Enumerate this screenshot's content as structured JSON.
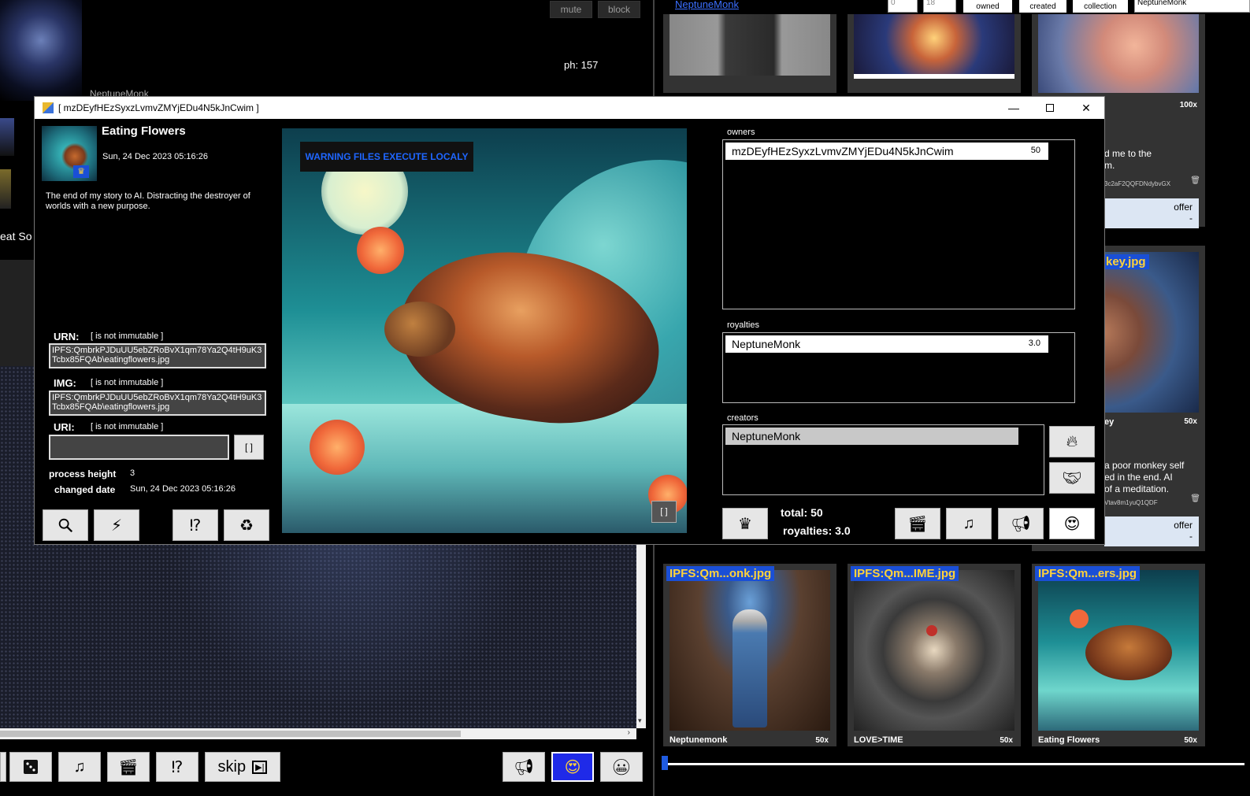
{
  "background_left": {
    "mute_label": "mute",
    "block_label": "block",
    "ph_text": "ph: 157",
    "partial_name": "NeptuneMonk",
    "partial_text": "eat So",
    "bottom_skip_label": "skip"
  },
  "background_right": {
    "top_link": "NeptuneMonk",
    "input1": "0",
    "input2": "18",
    "owned_label": "owned",
    "created_label": "created",
    "collection_label": "collection",
    "search_value": "NeptuneMonk",
    "card_count_top": "100x",
    "card_text_1": "d me to the\nm.",
    "card_hash_1": "3c2aF2QQFDNdybvGX",
    "offer_label": "offer",
    "offer_value": "-",
    "monkey_tag": "key.jpg",
    "monkey_title": "ey",
    "monkey_count": "50x",
    "monkey_text": "a poor monkey self\ned in the end. AI\nof a meditation.",
    "monkey_hash": "Vtav8m1yuQ1QDF",
    "bottom_cards": [
      {
        "tag": "IPFS:Qm...onk.jpg",
        "title": "Neptunemonk",
        "count": "50x"
      },
      {
        "tag": "IPFS:Qm...IME.jpg",
        "title": "LOVE>TIME",
        "count": "50x"
      },
      {
        "tag": "IPFS:Qm...ers.jpg",
        "title": "Eating Flowers",
        "count": "50x"
      }
    ]
  },
  "dialog": {
    "window_title": "[ mzDEyfHEzSyxzLvmvZMYjEDu4N5kJnCwim ]",
    "title": "Eating Flowers",
    "date": "Sun, 24 Dec 2023 05:16:26",
    "description": "The end of my story to AI. Distracting the destroyer of worlds with a new purpose.",
    "urn_label": "URN:",
    "urn_status": "[ is not immutable ]",
    "urn_value": "IPFS:QmbrkPJDuUU5ebZRoBvX1qm78Ya2Q4tH9uK3Tcbx85FQAb\\eatingflowers.jpg",
    "img_label": "IMG:",
    "img_status": "[ is not immutable ]",
    "img_value": "IPFS:QmbrkPJDuUU5ebZRoBvX1qm78Ya2Q4tH9uK3Tcbx85FQAb\\eatingflowers.jpg",
    "uri_label": "URI:",
    "uri_status": "[ is not immutable ]",
    "uri_value": "",
    "uri_btn": "[ ]",
    "process_height_label": "process height",
    "process_height_value": "3",
    "changed_date_label": "changed date",
    "changed_date_value": "Sun, 24 Dec 2023 05:16:26",
    "warning": "WARNING FILES EXECUTE LOCALY",
    "art_btn": "[ ]",
    "owners_label": "owners",
    "owners": [
      {
        "name": "mzDEyfHEzSyxzLvmvZMYjEDu4N5kJnCwim",
        "value": "50"
      }
    ],
    "royalties_label": "royalties",
    "royalties": [
      {
        "name": "NeptuneMonk",
        "value": "3.0"
      }
    ],
    "creators_label": "creators",
    "creators": [
      {
        "name": "NeptuneMonk"
      }
    ],
    "total_text": "total: 50",
    "royalties_text": "royalties: 3.0"
  }
}
